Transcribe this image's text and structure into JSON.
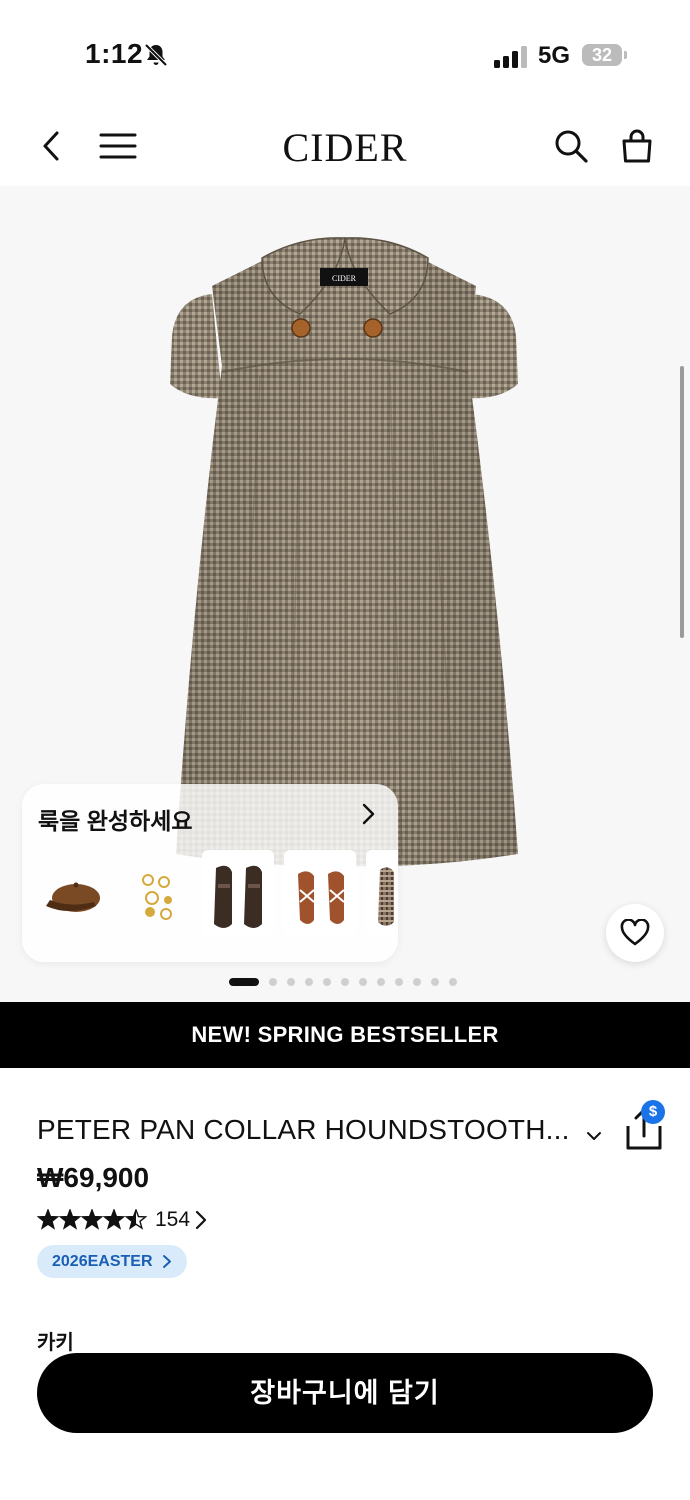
{
  "status_bar": {
    "time": "1:12",
    "network": "5G",
    "battery": "32"
  },
  "nav": {
    "logo": "CIDER",
    "icons": [
      "back-chevron-icon",
      "menu-icon",
      "search-icon",
      "shopping-bag-icon"
    ]
  },
  "hero": {
    "carousel_total": 12,
    "carousel_index": 1,
    "complete_look": {
      "title": "룩을 완성하세요",
      "items": [
        "brown-cap",
        "gold-jewelry",
        "brown-loafers",
        "strappy-heels",
        "plaid-flats"
      ]
    }
  },
  "banner": {
    "text": "NEW! SPRING BESTSELLER"
  },
  "product": {
    "title": "PETER PAN COLLAR HOUNDSTOOTH...",
    "price": "₩69,900",
    "rating": 4.5,
    "review_count": "154",
    "promo_tag": "2026EASTER",
    "share_badge": "$",
    "color_label": "카키"
  },
  "cta": {
    "add_to_cart": "장바구니에 담기"
  },
  "colors": {
    "accent_blue": "#1a73e8",
    "promo_bg": "#d9ebfb",
    "promo_text": "#1a5fb4",
    "black": "#000000"
  }
}
